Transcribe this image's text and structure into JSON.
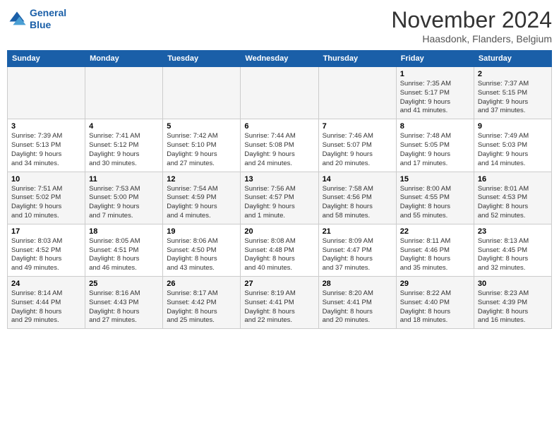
{
  "header": {
    "logo_line1": "General",
    "logo_line2": "Blue",
    "month": "November 2024",
    "location": "Haasdonk, Flanders, Belgium"
  },
  "weekdays": [
    "Sunday",
    "Monday",
    "Tuesday",
    "Wednesday",
    "Thursday",
    "Friday",
    "Saturday"
  ],
  "weeks": [
    [
      {
        "day": "",
        "info": ""
      },
      {
        "day": "",
        "info": ""
      },
      {
        "day": "",
        "info": ""
      },
      {
        "day": "",
        "info": ""
      },
      {
        "day": "",
        "info": ""
      },
      {
        "day": "1",
        "info": "Sunrise: 7:35 AM\nSunset: 5:17 PM\nDaylight: 9 hours\nand 41 minutes."
      },
      {
        "day": "2",
        "info": "Sunrise: 7:37 AM\nSunset: 5:15 PM\nDaylight: 9 hours\nand 37 minutes."
      }
    ],
    [
      {
        "day": "3",
        "info": "Sunrise: 7:39 AM\nSunset: 5:13 PM\nDaylight: 9 hours\nand 34 minutes."
      },
      {
        "day": "4",
        "info": "Sunrise: 7:41 AM\nSunset: 5:12 PM\nDaylight: 9 hours\nand 30 minutes."
      },
      {
        "day": "5",
        "info": "Sunrise: 7:42 AM\nSunset: 5:10 PM\nDaylight: 9 hours\nand 27 minutes."
      },
      {
        "day": "6",
        "info": "Sunrise: 7:44 AM\nSunset: 5:08 PM\nDaylight: 9 hours\nand 24 minutes."
      },
      {
        "day": "7",
        "info": "Sunrise: 7:46 AM\nSunset: 5:07 PM\nDaylight: 9 hours\nand 20 minutes."
      },
      {
        "day": "8",
        "info": "Sunrise: 7:48 AM\nSunset: 5:05 PM\nDaylight: 9 hours\nand 17 minutes."
      },
      {
        "day": "9",
        "info": "Sunrise: 7:49 AM\nSunset: 5:03 PM\nDaylight: 9 hours\nand 14 minutes."
      }
    ],
    [
      {
        "day": "10",
        "info": "Sunrise: 7:51 AM\nSunset: 5:02 PM\nDaylight: 9 hours\nand 10 minutes."
      },
      {
        "day": "11",
        "info": "Sunrise: 7:53 AM\nSunset: 5:00 PM\nDaylight: 9 hours\nand 7 minutes."
      },
      {
        "day": "12",
        "info": "Sunrise: 7:54 AM\nSunset: 4:59 PM\nDaylight: 9 hours\nand 4 minutes."
      },
      {
        "day": "13",
        "info": "Sunrise: 7:56 AM\nSunset: 4:57 PM\nDaylight: 9 hours\nand 1 minute."
      },
      {
        "day": "14",
        "info": "Sunrise: 7:58 AM\nSunset: 4:56 PM\nDaylight: 8 hours\nand 58 minutes."
      },
      {
        "day": "15",
        "info": "Sunrise: 8:00 AM\nSunset: 4:55 PM\nDaylight: 8 hours\nand 55 minutes."
      },
      {
        "day": "16",
        "info": "Sunrise: 8:01 AM\nSunset: 4:53 PM\nDaylight: 8 hours\nand 52 minutes."
      }
    ],
    [
      {
        "day": "17",
        "info": "Sunrise: 8:03 AM\nSunset: 4:52 PM\nDaylight: 8 hours\nand 49 minutes."
      },
      {
        "day": "18",
        "info": "Sunrise: 8:05 AM\nSunset: 4:51 PM\nDaylight: 8 hours\nand 46 minutes."
      },
      {
        "day": "19",
        "info": "Sunrise: 8:06 AM\nSunset: 4:50 PM\nDaylight: 8 hours\nand 43 minutes."
      },
      {
        "day": "20",
        "info": "Sunrise: 8:08 AM\nSunset: 4:48 PM\nDaylight: 8 hours\nand 40 minutes."
      },
      {
        "day": "21",
        "info": "Sunrise: 8:09 AM\nSunset: 4:47 PM\nDaylight: 8 hours\nand 37 minutes."
      },
      {
        "day": "22",
        "info": "Sunrise: 8:11 AM\nSunset: 4:46 PM\nDaylight: 8 hours\nand 35 minutes."
      },
      {
        "day": "23",
        "info": "Sunrise: 8:13 AM\nSunset: 4:45 PM\nDaylight: 8 hours\nand 32 minutes."
      }
    ],
    [
      {
        "day": "24",
        "info": "Sunrise: 8:14 AM\nSunset: 4:44 PM\nDaylight: 8 hours\nand 29 minutes."
      },
      {
        "day": "25",
        "info": "Sunrise: 8:16 AM\nSunset: 4:43 PM\nDaylight: 8 hours\nand 27 minutes."
      },
      {
        "day": "26",
        "info": "Sunrise: 8:17 AM\nSunset: 4:42 PM\nDaylight: 8 hours\nand 25 minutes."
      },
      {
        "day": "27",
        "info": "Sunrise: 8:19 AM\nSunset: 4:41 PM\nDaylight: 8 hours\nand 22 minutes."
      },
      {
        "day": "28",
        "info": "Sunrise: 8:20 AM\nSunset: 4:41 PM\nDaylight: 8 hours\nand 20 minutes."
      },
      {
        "day": "29",
        "info": "Sunrise: 8:22 AM\nSunset: 4:40 PM\nDaylight: 8 hours\nand 18 minutes."
      },
      {
        "day": "30",
        "info": "Sunrise: 8:23 AM\nSunset: 4:39 PM\nDaylight: 8 hours\nand 16 minutes."
      }
    ]
  ]
}
